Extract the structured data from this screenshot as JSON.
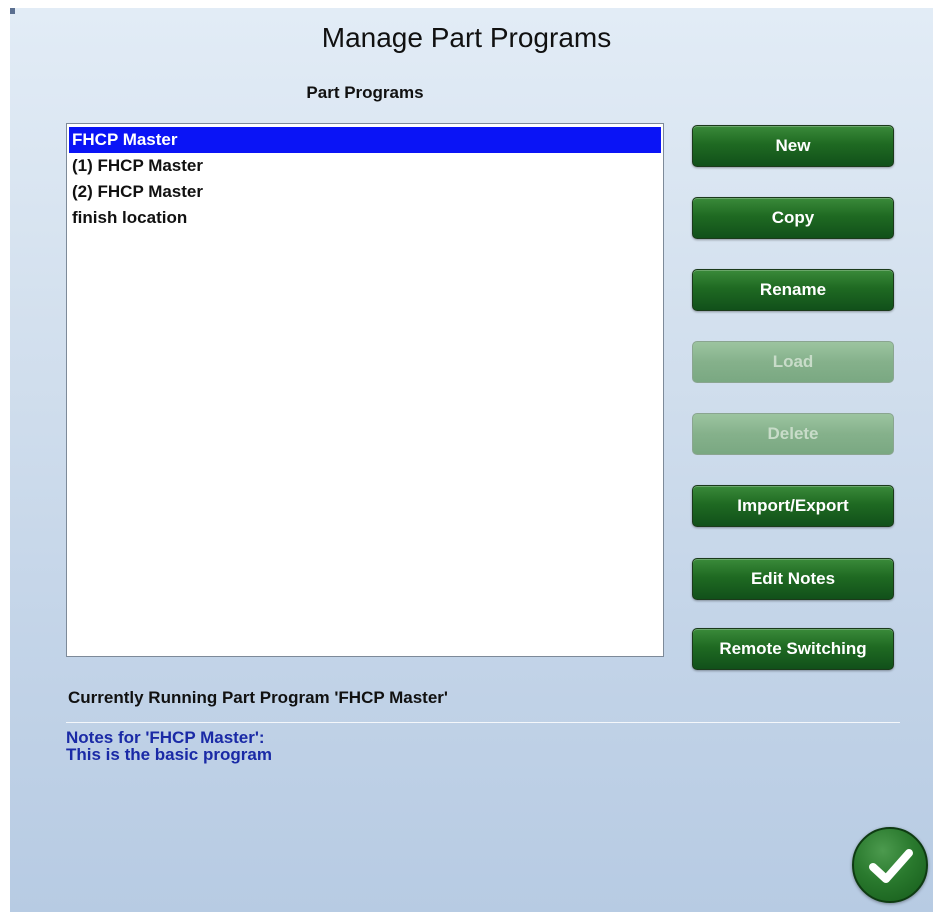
{
  "dialog": {
    "title": "Manage Part Programs"
  },
  "list": {
    "label": "Part Programs",
    "items": [
      {
        "label": "FHCP Master",
        "selected": true
      },
      {
        "label": "(1) FHCP Master",
        "selected": false
      },
      {
        "label": "(2) FHCP Master",
        "selected": false
      },
      {
        "label": "finish location",
        "selected": false
      }
    ]
  },
  "buttons": {
    "new": {
      "label": "New",
      "enabled": true
    },
    "copy": {
      "label": "Copy",
      "enabled": true
    },
    "rename": {
      "label": "Rename",
      "enabled": true
    },
    "load": {
      "label": "Load",
      "enabled": false
    },
    "delete": {
      "label": "Delete",
      "enabled": false
    },
    "import_export": {
      "label": "Import/Export",
      "enabled": true
    },
    "edit_notes": {
      "label": "Edit Notes",
      "enabled": true
    },
    "remote_switching": {
      "label": "Remote Switching",
      "enabled": true
    }
  },
  "status": {
    "running": "Currently Running Part Program 'FHCP Master'"
  },
  "notes": {
    "title": "Notes for 'FHCP Master':",
    "body": "This is the basic program"
  },
  "ok": {
    "icon": "checkmark-icon"
  },
  "colors": {
    "selection": "#0a14f6",
    "button_green": "#1f6a22",
    "notes_text": "#1a2aa6"
  }
}
